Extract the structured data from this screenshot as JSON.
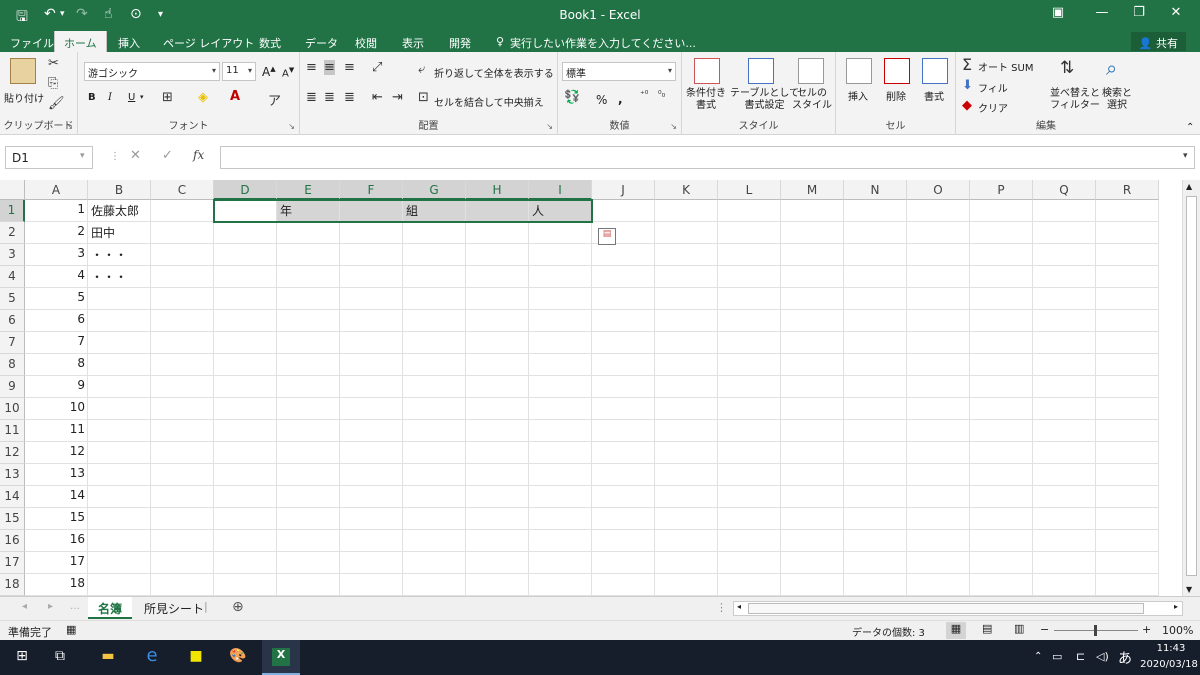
{
  "window": {
    "title": "Book1 - Excel"
  },
  "ribbon_tabs": [
    "ファイル",
    "ホーム",
    "挿入",
    "ページ レイアウト",
    "数式",
    "データ",
    "校閲",
    "表示",
    "開発"
  ],
  "tellme": "実行したい作業を入力してください...",
  "share": "共有",
  "clipboard": {
    "paste": "貼り付け",
    "label": "クリップボード"
  },
  "font": {
    "name": "游ゴシック",
    "size": "11",
    "bold": "B",
    "italic": "I",
    "underline": "U",
    "label": "フォント",
    "grow": "A",
    "shrink": "A"
  },
  "align": {
    "wrap": "折り返して全体を表示する",
    "merge": "セルを結合して中央揃え",
    "label": "配置"
  },
  "number": {
    "format": "標準",
    "percent": "%",
    "comma": ",",
    "label": "数値"
  },
  "style": {
    "cond": "条件付き\n書式",
    "table": "テーブルとして\n書式設定",
    "cell": "セルの\nスタイル",
    "label": "スタイル"
  },
  "cells": {
    "insert": "挿入",
    "delete": "削除",
    "format": "書式",
    "label": "セル"
  },
  "edit": {
    "autosum": "オート SUM",
    "fill": "フィル",
    "clear": "クリア",
    "sort": "並べ替えと\nフィルター",
    "find": "検索と\n選択",
    "label": "編集"
  },
  "namebox": "D1",
  "fx": "fx",
  "columns": [
    "A",
    "B",
    "C",
    "D",
    "E",
    "F",
    "G",
    "H",
    "I",
    "J",
    "K",
    "L",
    "M",
    "N",
    "O",
    "P",
    "Q",
    "R"
  ],
  "rows": [
    "1",
    "2",
    "3",
    "4",
    "5",
    "6",
    "7",
    "8",
    "9",
    "10",
    "11",
    "12",
    "13",
    "14",
    "15",
    "16",
    "17",
    "18"
  ],
  "colA": [
    "1",
    "2",
    "3",
    "4",
    "5",
    "6",
    "7",
    "8",
    "9",
    "10",
    "11",
    "12",
    "13",
    "14",
    "15",
    "16",
    "17",
    "18"
  ],
  "colB": [
    "佐藤太郎",
    "田中",
    "・・・",
    "・・・"
  ],
  "row1": {
    "E": "年",
    "G": "組",
    "I": "人"
  },
  "sheets": [
    "名簿",
    "所見シート"
  ],
  "status": {
    "ready": "準備完了",
    "count": "データの個数: 3",
    "zoom": "100%"
  },
  "clock": {
    "time": "11:43",
    "date": "2020/03/18"
  },
  "ime": "あ",
  "accent": "#217346"
}
